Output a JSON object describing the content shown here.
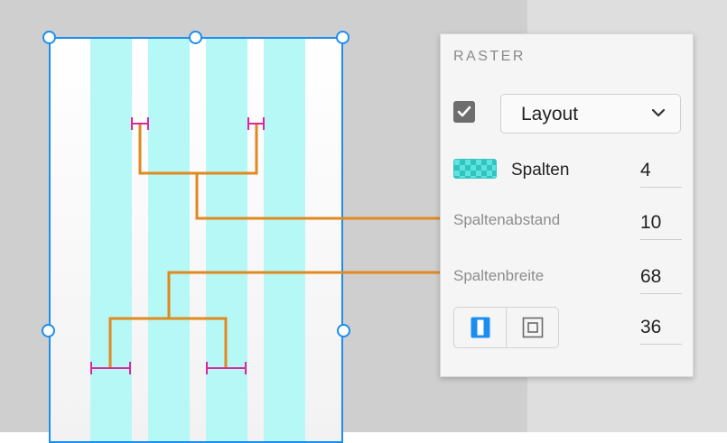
{
  "panel": {
    "title": "RASTER",
    "layout_checkbox_checked": true,
    "layout_dropdown": {
      "selected": "Layout",
      "icon": "chevron-down-icon"
    },
    "columns": {
      "label": "Spalten",
      "icon": "columns-grid-icon",
      "value": "4"
    },
    "gutter": {
      "label": "Spaltenabstand",
      "value": "10"
    },
    "column_width": {
      "label": "Spaltenbreite",
      "value": "68"
    },
    "margin": {
      "linked_icon": "linked-margins-icon",
      "individual_icon": "individual-margins-icon",
      "value": "36"
    }
  },
  "colors": {
    "selection": "#1b8ef0",
    "grid_column": "#b6f8f6",
    "callout_line": "#e0891f",
    "measure_marker": "#e0249a",
    "checkbox_fill": "#6e6e6e"
  },
  "canvas": {
    "column_count": 4
  }
}
